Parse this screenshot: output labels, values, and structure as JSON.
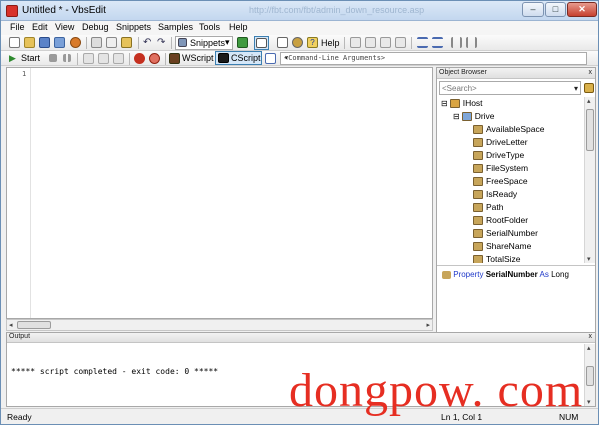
{
  "window": {
    "title": "Untitled * - VbsEdit",
    "faded_title_text": "http://fbt.com/fbt/admin_down_resource.asp",
    "min_label": "–",
    "max_label": "□",
    "close_label": "✕"
  },
  "menu": [
    "File",
    "Edit",
    "View",
    "Debug",
    "Snippets",
    "Samples",
    "Tools",
    "Help"
  ],
  "toolbar1": {
    "snippets_label": "Snippets",
    "help_label": "Help"
  },
  "toolbar2": {
    "start_label": "Start",
    "wscript_label": "WScript",
    "cscript_label": "CScript",
    "cmdline_placeholder": "<Command-Line Arguments>"
  },
  "editor": {
    "line_numbers": [
      "1"
    ],
    "content": ""
  },
  "object_browser": {
    "header": "Object Browser",
    "close_label": "x",
    "search_placeholder": "<Search>",
    "tree": [
      {
        "label": "IHost",
        "level": 0,
        "expander": "⊟",
        "icon_color": "#d9a441"
      },
      {
        "label": "Drive",
        "level": 1,
        "expander": "⊟",
        "icon_color": "#7fa6d8"
      },
      {
        "label": "AvailableSpace",
        "level": 2,
        "icon_color": "#c7a55a"
      },
      {
        "label": "DriveLetter",
        "level": 2,
        "icon_color": "#c7a55a"
      },
      {
        "label": "DriveType",
        "level": 2,
        "icon_color": "#c7a55a"
      },
      {
        "label": "FileSystem",
        "level": 2,
        "icon_color": "#c7a55a"
      },
      {
        "label": "FreeSpace",
        "level": 2,
        "icon_color": "#c7a55a"
      },
      {
        "label": "IsReady",
        "level": 2,
        "icon_color": "#c7a55a"
      },
      {
        "label": "Path",
        "level": 2,
        "icon_color": "#c7a55a"
      },
      {
        "label": "RootFolder",
        "level": 2,
        "icon_color": "#c7a55a"
      },
      {
        "label": "SerialNumber",
        "level": 2,
        "icon_color": "#c7a55a"
      },
      {
        "label": "ShareName",
        "level": 2,
        "icon_color": "#c7a55a"
      },
      {
        "label": "TotalSize",
        "level": 2,
        "icon_color": "#c7a55a"
      }
    ],
    "description": {
      "kind": "Property",
      "name": "SerialNumber",
      "as": "As",
      "type": "Long"
    }
  },
  "output": {
    "header": "Output",
    "close_label": "x",
    "text": "***** script completed - exit code: 0 *****"
  },
  "status": {
    "ready": "Ready",
    "position": "Ln 1, Col 1",
    "num": "NUM"
  },
  "watermark": "dongpow. com",
  "colors": {
    "accent_blue": "#1f39c9",
    "watermark_red": "#e62e22",
    "title_gradient": "#c3d7ef"
  }
}
